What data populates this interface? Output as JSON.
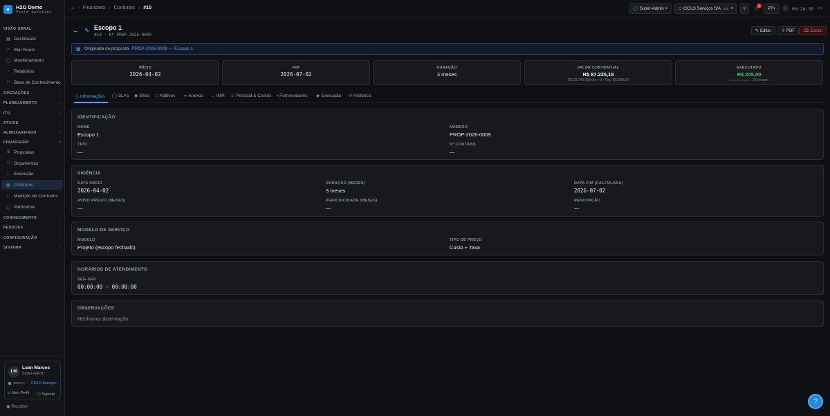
{
  "brand": {
    "name": "H2O Demo",
    "subtitle": "Field Services"
  },
  "sidebar": {
    "sections": [
      {
        "label": "VISÃO GERAL"
      },
      {
        "label": "OPERAÇÕES"
      },
      {
        "label": "PLANEJAMENTO"
      },
      {
        "label": "ITIL"
      },
      {
        "label": "ATIVOS"
      },
      {
        "label": "ALMOXARIFADO"
      },
      {
        "label": "FINANCEIRO"
      },
      {
        "label": "CONHECIMENTO"
      },
      {
        "label": "PESSOAS"
      },
      {
        "label": "CONFIGURAÇÃO"
      },
      {
        "label": "SISTEMA"
      }
    ],
    "items": [
      {
        "label": "Dashboard",
        "icon": "grid-icon"
      },
      {
        "label": "War Room",
        "icon": "radio-icon"
      },
      {
        "label": "Monitoramento",
        "icon": "activity-icon"
      },
      {
        "label": "Relatórios",
        "icon": "bar-chart-icon"
      },
      {
        "label": "Base de Conhecimento",
        "icon": "book-icon"
      },
      {
        "label": "Propostas",
        "icon": "dollar-icon"
      },
      {
        "label": "Orçamentos",
        "icon": "file-icon"
      },
      {
        "label": "Execução",
        "icon": "chart-icon"
      },
      {
        "label": "Contratos",
        "icon": "document-icon"
      },
      {
        "label": "Medição de Contratos",
        "icon": "ruler-icon"
      },
      {
        "label": "Patrimônio",
        "icon": "clock-icon"
      }
    ],
    "active_item": "Contratos",
    "collapse_label": "Recolher"
  },
  "user": {
    "initials": "LM",
    "name": "Luan Marcos",
    "role": "Super-Admin",
    "status": "zone.s...",
    "company": "CICLO Serviços...",
    "profile_link": "Meu Perfil",
    "support_link": "Suporte"
  },
  "topbar": {
    "breadcrumb": [
      "Financeiro",
      "Contratos",
      "#10"
    ],
    "role_select": "Super-Admin",
    "company_select": "CICLO Serviços S/A",
    "company_tag": "Hub",
    "notifications": "1",
    "language": "PT",
    "clock": "09:24:39"
  },
  "header": {
    "title": "Escopo 1",
    "subtitle": "#10 · Nº PROP-2026-0009",
    "edit_label": "Editar",
    "pdf_label": "PDF",
    "delete_label": "Excluir"
  },
  "origin": {
    "prefix": "Originada da proposta",
    "link": "PROP-2026-0009 — Escopo 1"
  },
  "stats": [
    {
      "label": "INÍCIO",
      "value": "2026-04-02",
      "sub": ""
    },
    {
      "label": "FIM",
      "value": "2026-07-02",
      "sub": ""
    },
    {
      "label": "DURAÇÃO",
      "value": "3 meses",
      "sub": ""
    },
    {
      "label": "VALOR CONTRATUAL",
      "value": "R$ 87.225,18",
      "sub": "R$ 29.745,00/mês × 3 • Orç. R$ 980,18"
    },
    {
      "label": "EXECUTADO",
      "value": "R$ 245,00",
      "sub": "1/3 meses",
      "progress": 0.0
    }
  ],
  "tabs": [
    {
      "label": "Informações",
      "icon": "info-icon"
    },
    {
      "label": "SLAs",
      "icon": "shield-icon"
    },
    {
      "label": "Sites",
      "icon": "pin-icon"
    },
    {
      "label": "Aditivos",
      "icon": "file-icon"
    },
    {
      "label": "Anexos",
      "icon": "paperclip-icon"
    },
    {
      "label": "IMR",
      "icon": "chart-icon"
    },
    {
      "label": "Pessoal & Custos",
      "icon": "users-icon"
    },
    {
      "label": "Fornecedores",
      "icon": "truck-icon"
    },
    {
      "label": "Execução",
      "icon": "play-icon"
    },
    {
      "label": "Histórico",
      "icon": "history-icon"
    }
  ],
  "sections": {
    "identificacao": {
      "title": "IDENTIFICAÇÃO",
      "fields": [
        {
          "label": "NOME",
          "value": "Escopo 1"
        },
        {
          "label": "NÚMERO",
          "value": "PROP-2026-0009"
        },
        {
          "label": "TIPO",
          "value": "—"
        },
        {
          "label": "Nº CONTÁBIL",
          "value": "—"
        }
      ]
    },
    "vigencia": {
      "title": "VIGÊNCIA",
      "fields": [
        {
          "label": "DATA INÍCIO",
          "value": "2026-04-02"
        },
        {
          "label": "DURAÇÃO (MESES)",
          "value": "3 meses"
        },
        {
          "label": "DATA FIM (CALCULADA)",
          "value": "2026-07-02"
        },
        {
          "label": "AVISO PRÉVIO (MESES)",
          "value": "—"
        },
        {
          "label": "PERIODICIDADE (MESES)",
          "value": "—"
        },
        {
          "label": "RENOVAÇÃO",
          "value": "—"
        }
      ]
    },
    "modelo": {
      "title": "MODELO DE SERVIÇO",
      "fields": [
        {
          "label": "MODELO",
          "value": "Projeto (escopo fechado)"
        },
        {
          "label": "TIPO DE PREÇO",
          "value": "Custo + Taxa"
        }
      ]
    },
    "horarios": {
      "title": "HORÁRIOS DE ATENDIMENTO",
      "day_label": "SEG-SEX",
      "hours": "00:00:00 — 00:00:00"
    },
    "observacoes": {
      "title": "OBSERVAÇÕES",
      "text": "Nenhuma observação."
    }
  }
}
